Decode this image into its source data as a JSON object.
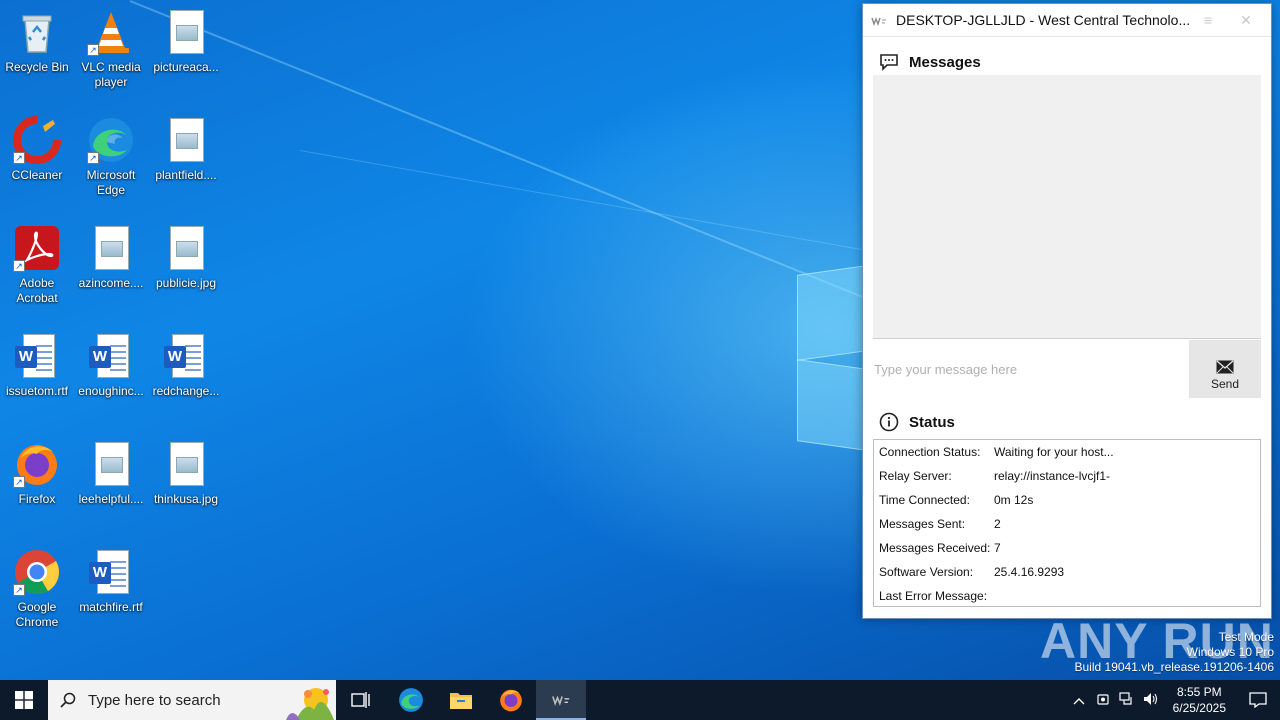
{
  "desktop": {
    "icons": [
      {
        "label": "Recycle Bin",
        "icon": "recycle-bin-icon"
      },
      {
        "label": "VLC media player",
        "icon": "vlc-icon"
      },
      {
        "label": "pictureaca...",
        "icon": "image-file-icon"
      },
      {
        "label": "CCleaner",
        "icon": "ccleaner-icon"
      },
      {
        "label": "Microsoft Edge",
        "icon": "edge-icon"
      },
      {
        "label": "plantfield....",
        "icon": "image-file-icon"
      },
      {
        "label": "Adobe Acrobat",
        "icon": "acrobat-icon"
      },
      {
        "label": "azincome....",
        "icon": "image-file-icon"
      },
      {
        "label": "publicie.jpg",
        "icon": "image-file-icon"
      },
      {
        "label": "issuetom.rtf",
        "icon": "word-file-icon"
      },
      {
        "label": "enoughinc...",
        "icon": "word-file-icon"
      },
      {
        "label": "redchange...",
        "icon": "word-file-icon"
      },
      {
        "label": "Firefox",
        "icon": "firefox-icon"
      },
      {
        "label": "leehelpful....",
        "icon": "image-file-icon"
      },
      {
        "label": "thinkusa.jpg",
        "icon": "image-file-icon"
      },
      {
        "label": "Google Chrome",
        "icon": "chrome-icon"
      },
      {
        "label": "matchfire.rtf",
        "icon": "word-file-icon"
      }
    ]
  },
  "window": {
    "title": "DESKTOP-JGLLJLD - West Central Technolo...",
    "messages_heading": "Messages",
    "input_placeholder": "Type your message here",
    "send_label": "Send",
    "status_heading": "Status",
    "status_rows": [
      {
        "key": "Connection Status:",
        "value": "Waiting for your host..."
      },
      {
        "key": "Relay Server:",
        "value": "relay://instance-lvcjf1-"
      },
      {
        "key": "Time Connected:",
        "value": "0m 12s"
      },
      {
        "key": "Messages Sent:",
        "value": "2"
      },
      {
        "key": "Messages Received:",
        "value": "7"
      },
      {
        "key": "Software Version:",
        "value": "25.4.16.9293"
      },
      {
        "key": "Last Error Message:",
        "value": ""
      }
    ]
  },
  "watermark": {
    "brand": "ANY RUN",
    "line1": "Test Mode",
    "line2": "Windows 10 Pro",
    "line3": "Build 19041.vb_release.191206-1406"
  },
  "taskbar": {
    "search_placeholder": "Type here to search",
    "time": "8:55 PM",
    "date": "6/25/2025",
    "apps": [
      "task-view-icon",
      "edge-icon",
      "file-explorer-icon",
      "firefox-icon",
      "remote-support-app-icon"
    ]
  },
  "colors": {
    "desktop_blue": "#0a74d6",
    "taskbar": "#0d1a2b",
    "message_area": "#f0f0f0"
  }
}
